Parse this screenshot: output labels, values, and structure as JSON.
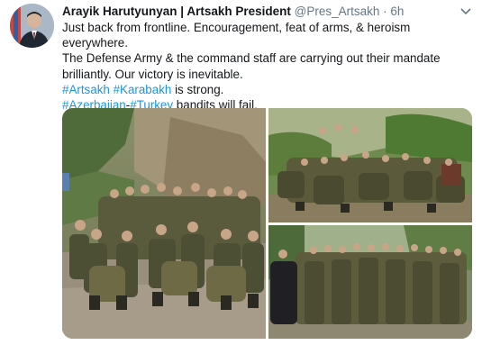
{
  "tweet": {
    "author_name": "Arayik Harutyunyan | Artsakh President",
    "handle": "@Pres_Artsakh",
    "separator": "·",
    "time": "6h",
    "text_line1": "Just back from frontline. Encouragement, feat of arms, & heroism everywhere.",
    "text_line2": "The Defense Army & the command staff are carrying out their mandate",
    "text_line3": "brilliantly. Our victory is inevitable.",
    "hashtag_artsakh": "#Artsakh",
    "hashtag_karabakh": "#Karabakh",
    "text_is_strong": " is strong.",
    "hashtag_azerbaijan": "#Azerbaijan",
    "dash": "-",
    "hashtag_turkey": "#Turkey",
    "text_bandits": " bandits will fail."
  },
  "colors": {
    "link": "#1b95e0",
    "text": "#14171a",
    "secondary": "#657786"
  },
  "icons": {
    "more": "chevron-down-icon"
  }
}
